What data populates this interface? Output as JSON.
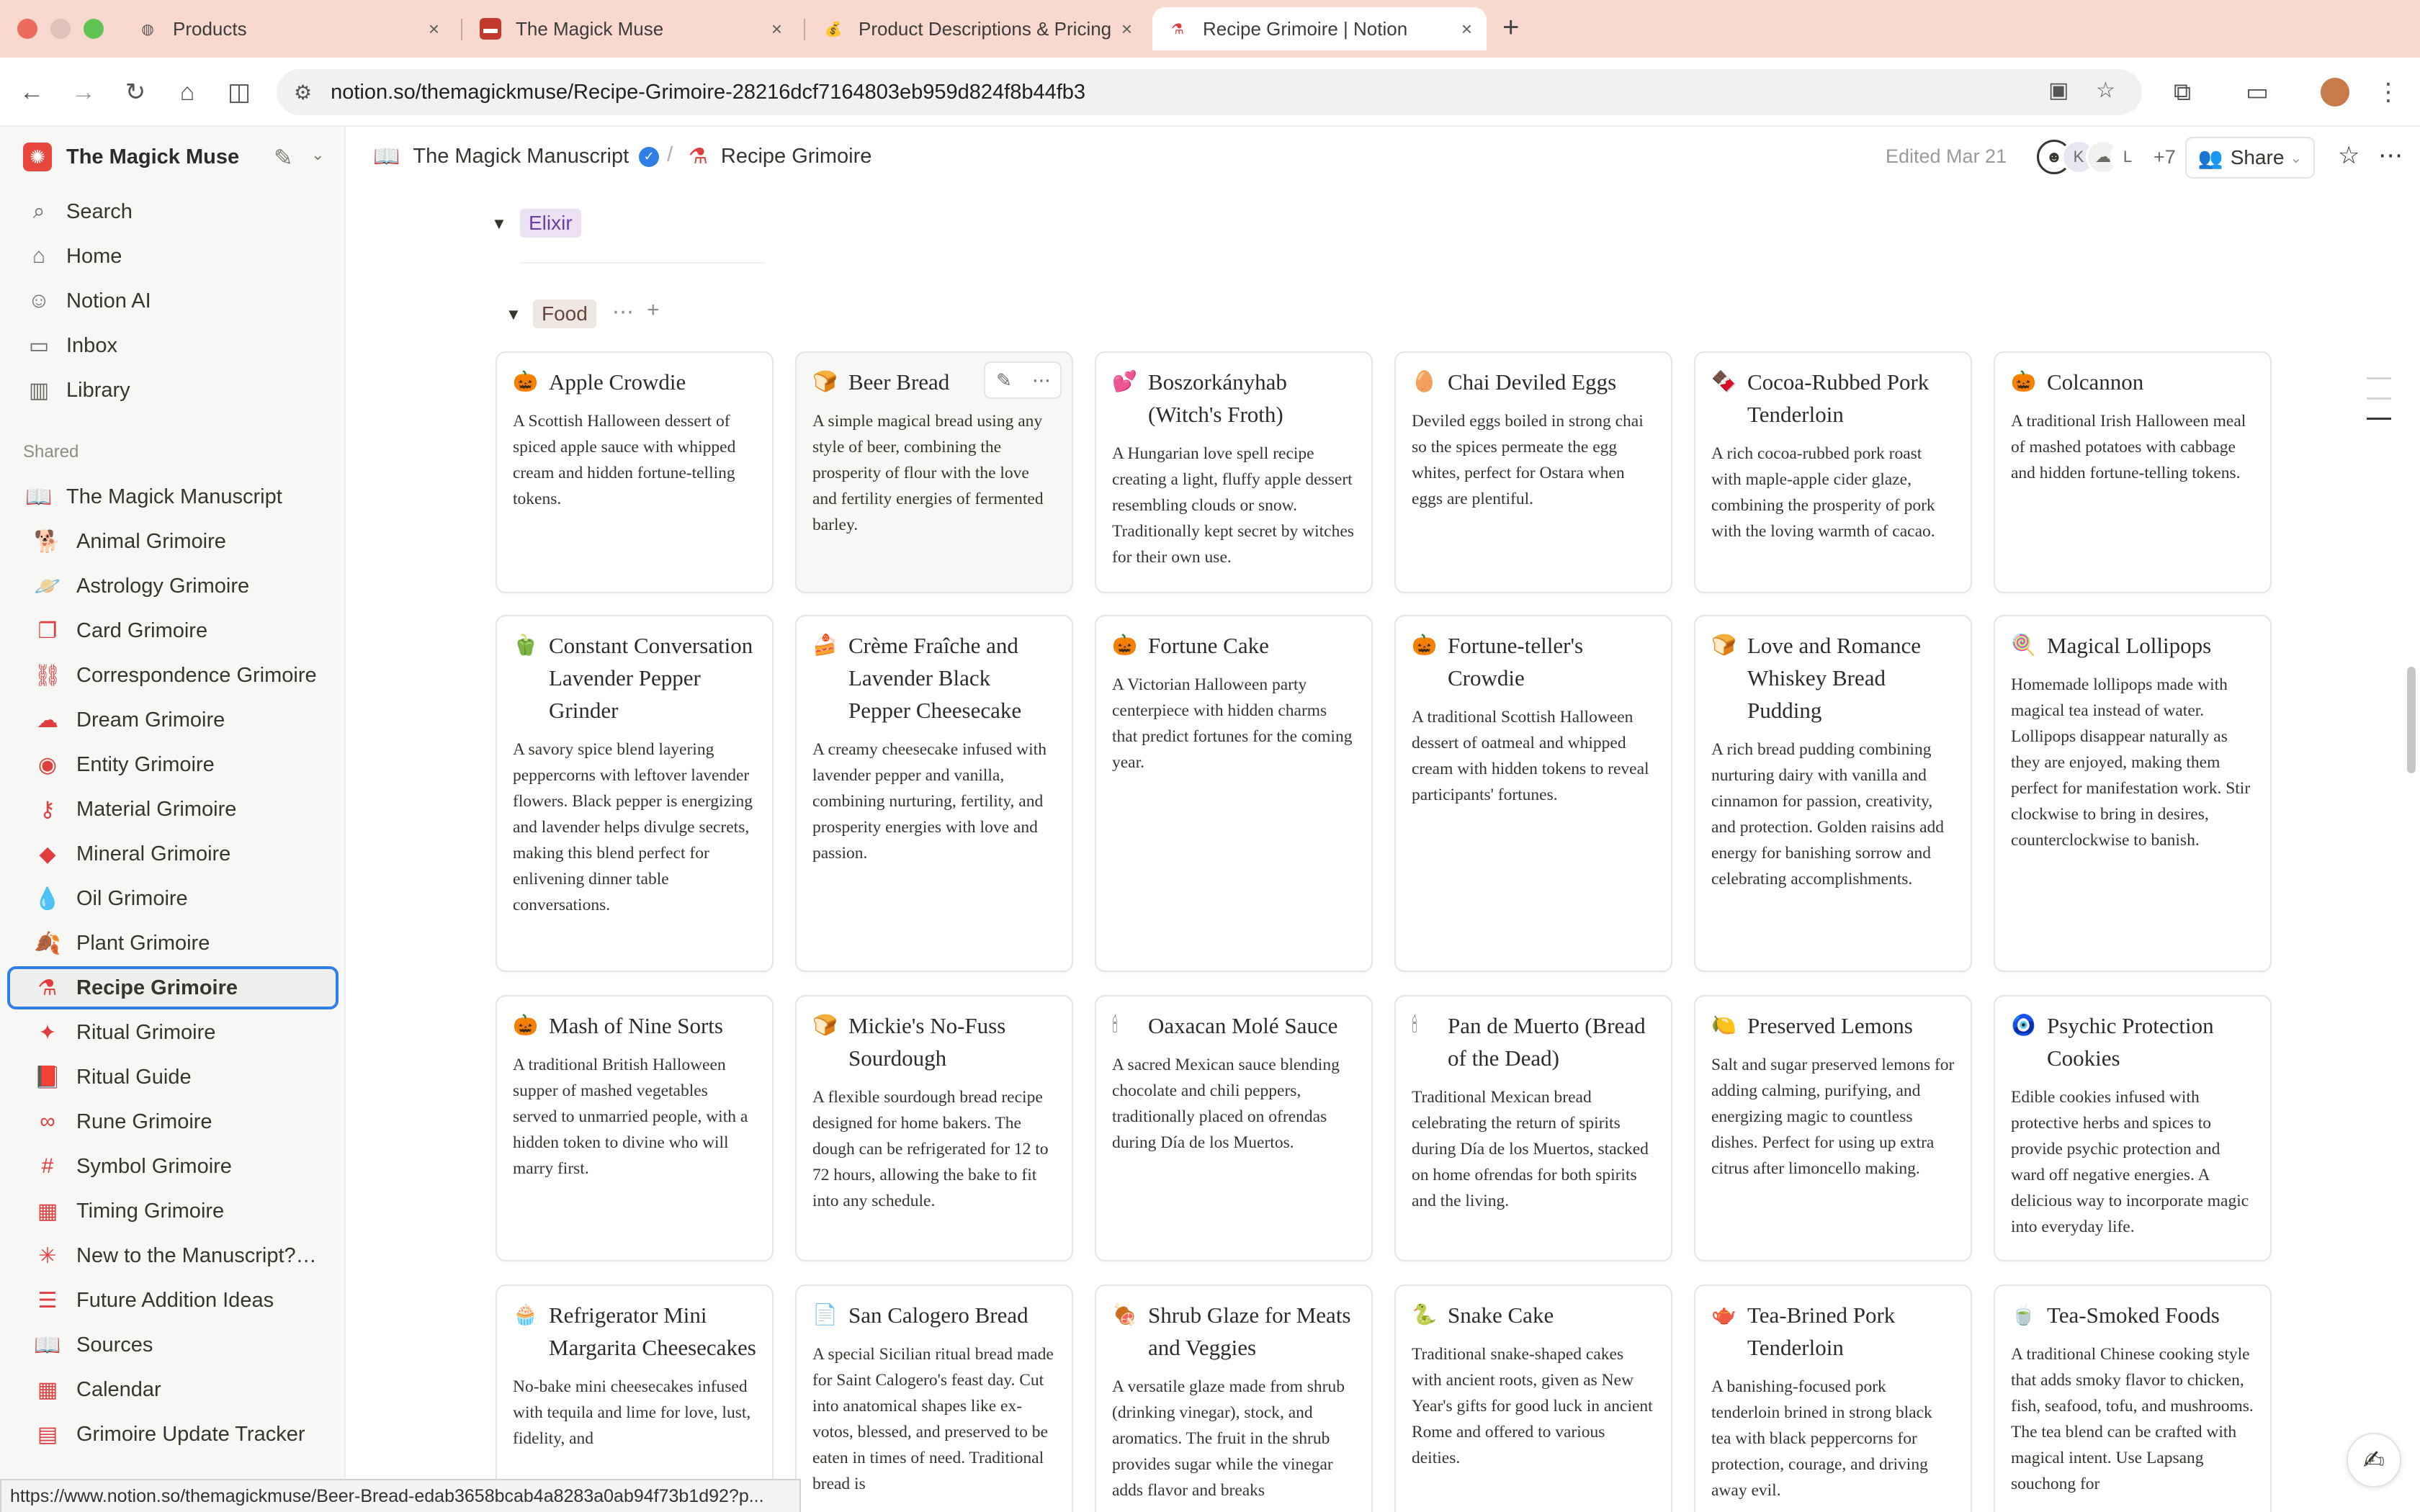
{
  "browser": {
    "tabs": [
      {
        "label": "Products",
        "icon": "globe-icon"
      },
      {
        "label": "The Magick Muse",
        "icon": "magick-muse-icon"
      },
      {
        "label": "Product Descriptions & Pricing",
        "icon": "moneybag-icon"
      },
      {
        "label": "Recipe Grimoire | Notion",
        "icon": "flask-icon",
        "active": true
      }
    ],
    "url": "notion.so/themagickmuse/Recipe-Grimoire-28216dcf7164803eb959d824f8b44fb3",
    "status_url": "https://www.notion.so/themagickmuse/Beer-Bread-edab3658bcab4a8283a0ab94f73b1d92?p..."
  },
  "sidebar": {
    "workspace": "The Magick Muse",
    "nav": [
      {
        "label": "Search",
        "icon": "search-icon"
      },
      {
        "label": "Home",
        "icon": "home-icon"
      },
      {
        "label": "Notion AI",
        "icon": "notion-ai-icon"
      },
      {
        "label": "Inbox",
        "icon": "inbox-icon"
      },
      {
        "label": "Library",
        "icon": "library-icon"
      }
    ],
    "section_label": "Shared",
    "parent_page": "The Magick Manuscript",
    "pages": [
      {
        "label": "Animal Grimoire",
        "icon": "dog-icon"
      },
      {
        "label": "Astrology Grimoire",
        "icon": "planet-icon"
      },
      {
        "label": "Card Grimoire",
        "icon": "cards-icon"
      },
      {
        "label": "Correspondence Grimoire",
        "icon": "link-icon"
      },
      {
        "label": "Dream Grimoire",
        "icon": "cloud-icon"
      },
      {
        "label": "Entity Grimoire",
        "icon": "eye-icon"
      },
      {
        "label": "Material Grimoire",
        "icon": "key-icon"
      },
      {
        "label": "Mineral Grimoire",
        "icon": "gem-icon"
      },
      {
        "label": "Oil Grimoire",
        "icon": "drop-icon"
      },
      {
        "label": "Plant Grimoire",
        "icon": "leaf-icon"
      },
      {
        "label": "Recipe Grimoire",
        "icon": "flask-icon",
        "selected": true
      },
      {
        "label": "Ritual Grimoire",
        "icon": "wand-icon"
      },
      {
        "label": "Ritual Guide",
        "icon": "book-icon"
      },
      {
        "label": "Rune Grimoire",
        "icon": "infinity-icon"
      },
      {
        "label": "Symbol Grimoire",
        "icon": "hash-icon"
      },
      {
        "label": "Timing Grimoire",
        "icon": "calendar-icon"
      },
      {
        "label": "New to the Manuscript? Start Here",
        "icon": "sparkle-icon"
      },
      {
        "label": "Future Addition Ideas",
        "icon": "list-icon"
      },
      {
        "label": "Sources",
        "icon": "open-book-icon"
      },
      {
        "label": "Calendar",
        "icon": "calendar-icon"
      },
      {
        "label": "Grimoire Update Tracker",
        "icon": "tracker-icon"
      }
    ]
  },
  "header": {
    "breadcrumb_parent": "The Magick Manuscript",
    "breadcrumb_current": "Recipe Grimoire",
    "edited": "Edited Mar 21",
    "avatar_letters": [
      "K",
      "L"
    ],
    "more_count": "+7",
    "share_label": "Share"
  },
  "board": {
    "collapsed_group": "Elixir",
    "group": "Food",
    "cards": [
      {
        "emoji": "🎃",
        "title": "Apple Crowdie",
        "desc": "A Scottish Halloween dessert of spiced apple sauce with whipped cream and hidden fortune-telling tokens."
      },
      {
        "emoji": "🍞",
        "title": "Beer Bread",
        "desc": "A simple magical bread using any style of beer, combining the prosperity of flour with the love and fertility energies of fermented barley.",
        "hovered": true
      },
      {
        "emoji": "💕",
        "title": "Boszorkányhab (Witch's Froth)",
        "desc": "A Hungarian love spell recipe creating a light, fluffy apple dessert resembling clouds or snow. Traditionally kept secret by witches for their own use."
      },
      {
        "emoji": "🥚",
        "title": "Chai Deviled Eggs",
        "desc": "Deviled eggs boiled in strong chai so the spices permeate the egg whites, perfect for Ostara when eggs are plentiful."
      },
      {
        "emoji": "🍫",
        "title": "Cocoa-Rubbed Pork Tenderloin",
        "desc": "A rich cocoa-rubbed pork roast with maple-apple cider glaze, combining the prosperity of pork with the loving warmth of cacao."
      },
      {
        "emoji": "🎃",
        "title": "Colcannon",
        "desc": "A traditional Irish Halloween meal of mashed potatoes with cabbage and hidden fortune-telling tokens."
      },
      {
        "emoji": "🫑",
        "title": "Constant Conversation Lavender Pepper Grinder",
        "desc": "A savory spice blend layering peppercorns with leftover lavender flowers. Black pepper is energizing and lavender helps divulge secrets, making this blend perfect for enlivening dinner table conversations."
      },
      {
        "emoji": "🍰",
        "title": "Crème Fraîche and Lavender Black Pepper Cheesecake",
        "desc": "A creamy cheesecake infused with lavender pepper and vanilla, combining nurturing, fertility, and prosperity energies with love and passion."
      },
      {
        "emoji": "🎃",
        "title": "Fortune Cake",
        "desc": "A Victorian Halloween party centerpiece with hidden charms that predict fortunes for the coming year."
      },
      {
        "emoji": "🎃",
        "title": "Fortune-teller's Crowdie",
        "desc": "A traditional Scottish Halloween dessert of oatmeal and whipped cream with hidden tokens to reveal participants' fortunes."
      },
      {
        "emoji": "🍞",
        "title": "Love and Romance Whiskey Bread Pudding",
        "desc": "A rich bread pudding combining nurturing dairy with vanilla and cinnamon for passion, creativity, and protection. Golden raisins add energy for banishing sorrow and celebrating accomplishments."
      },
      {
        "emoji": "🍭",
        "title": "Magical Lollipops",
        "desc": "Homemade lollipops made with magical tea instead of water. Lollipops disappear naturally as they are enjoyed, making them perfect for manifestation work. Stir clockwise to bring in desires, counterclockwise to banish."
      },
      {
        "emoji": "🎃",
        "title": "Mash of Nine Sorts",
        "desc": "A traditional British Halloween supper of mashed vegetables served to unmarried people, with a hidden token to divine who will marry first."
      },
      {
        "emoji": "🍞",
        "title": "Mickie's No-Fuss Sourdough",
        "desc": "A flexible sourdough bread recipe designed for home bakers. The dough can be refrigerated for 12 to 72 hours, allowing the bake to fit into any schedule."
      },
      {
        "emoji": "🕯",
        "title": "Oaxacan Molé Sauce",
        "desc": "A sacred Mexican sauce blending chocolate and chili peppers, traditionally placed on ofrendas during Día de los Muertos."
      },
      {
        "emoji": "🕯",
        "title": "Pan de Muerto (Bread of the Dead)",
        "desc": "Traditional Mexican bread celebrating the return of spirits during Día de los Muertos, stacked on home ofrendas for both spirits and the living."
      },
      {
        "emoji": "🍋",
        "title": "Preserved Lemons",
        "desc": "Salt and sugar preserved lemons for adding calming, purifying, and energizing magic to countless dishes. Perfect for using up extra citrus after limoncello making."
      },
      {
        "emoji": "🧿",
        "title": "Psychic Protection Cookies",
        "desc": "Edible cookies infused with protective herbs and spices to provide psychic protection and ward off negative energies. A delicious way to incorporate magic into everyday life."
      },
      {
        "emoji": "🧁",
        "title": "Refrigerator Mini Margarita Cheesecakes",
        "desc": "No-bake mini cheesecakes infused with tequila and lime for love, lust, fidelity, and"
      },
      {
        "emoji": "📄",
        "title": "San Calogero Bread",
        "desc": "A special Sicilian ritual bread made for Saint Calogero's feast day. Cut into anatomical shapes like ex-votos, blessed, and preserved to be eaten in times of need. Traditional bread is"
      },
      {
        "emoji": "🍖",
        "title": "Shrub Glaze for Meats and Veggies",
        "desc": "A versatile glaze made from shrub (drinking vinegar), stock, and aromatics. The fruit in the shrub provides sugar while the vinegar adds flavor and breaks"
      },
      {
        "emoji": "🐍",
        "title": "Snake Cake",
        "desc": "Traditional snake-shaped cakes with ancient roots, given as New Year's gifts for good luck in ancient Rome and offered to various deities."
      },
      {
        "emoji": "🫖",
        "title": "Tea-Brined Pork Tenderloin",
        "desc": "A banishing-focused pork tenderloin brined in strong black tea with black peppercorns for protection, courage, and driving away evil."
      },
      {
        "emoji": "🍵",
        "title": "Tea-Smoked Foods",
        "desc": "A traditional Chinese cooking style that adds smoky flavor to chicken, fish, seafood, tofu, and mushrooms. The tea blend can be crafted with magical intent. Use Lapsang souchong for"
      }
    ]
  },
  "colors": {
    "tabbar_bg": "#f9d9cf",
    "accent_blue": "#2f7fe6",
    "icon_red": "#e03e3e",
    "elixir_pill_bg": "#ebe1f3",
    "elixir_pill_text": "#6940a5",
    "food_pill_bg": "#efe7e1",
    "food_pill_text": "#64473a"
  }
}
